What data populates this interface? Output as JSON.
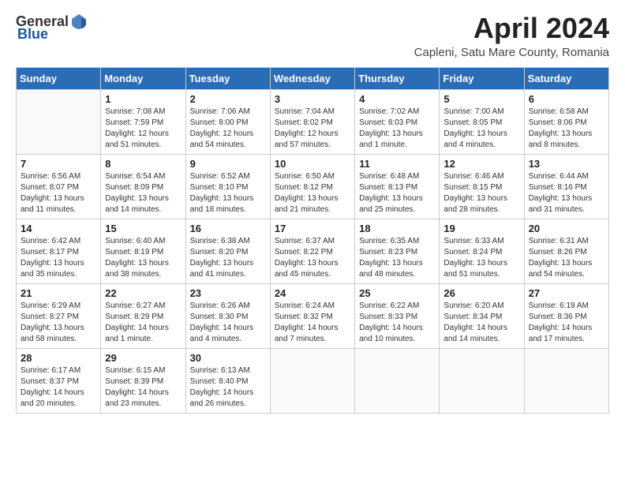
{
  "header": {
    "logo_general": "General",
    "logo_blue": "Blue",
    "month_title": "April 2024",
    "location": "Capleni, Satu Mare County, Romania"
  },
  "days_of_week": [
    "Sunday",
    "Monday",
    "Tuesday",
    "Wednesday",
    "Thursday",
    "Friday",
    "Saturday"
  ],
  "weeks": [
    [
      {
        "day": "",
        "sunrise": "",
        "sunset": "",
        "daylight": ""
      },
      {
        "day": "1",
        "sunrise": "Sunrise: 7:08 AM",
        "sunset": "Sunset: 7:59 PM",
        "daylight": "Daylight: 12 hours and 51 minutes."
      },
      {
        "day": "2",
        "sunrise": "Sunrise: 7:06 AM",
        "sunset": "Sunset: 8:00 PM",
        "daylight": "Daylight: 12 hours and 54 minutes."
      },
      {
        "day": "3",
        "sunrise": "Sunrise: 7:04 AM",
        "sunset": "Sunset: 8:02 PM",
        "daylight": "Daylight: 12 hours and 57 minutes."
      },
      {
        "day": "4",
        "sunrise": "Sunrise: 7:02 AM",
        "sunset": "Sunset: 8:03 PM",
        "daylight": "Daylight: 13 hours and 1 minute."
      },
      {
        "day": "5",
        "sunrise": "Sunrise: 7:00 AM",
        "sunset": "Sunset: 8:05 PM",
        "daylight": "Daylight: 13 hours and 4 minutes."
      },
      {
        "day": "6",
        "sunrise": "Sunrise: 6:58 AM",
        "sunset": "Sunset: 8:06 PM",
        "daylight": "Daylight: 13 hours and 8 minutes."
      }
    ],
    [
      {
        "day": "7",
        "sunrise": "Sunrise: 6:56 AM",
        "sunset": "Sunset: 8:07 PM",
        "daylight": "Daylight: 13 hours and 11 minutes."
      },
      {
        "day": "8",
        "sunrise": "Sunrise: 6:54 AM",
        "sunset": "Sunset: 8:09 PM",
        "daylight": "Daylight: 13 hours and 14 minutes."
      },
      {
        "day": "9",
        "sunrise": "Sunrise: 6:52 AM",
        "sunset": "Sunset: 8:10 PM",
        "daylight": "Daylight: 13 hours and 18 minutes."
      },
      {
        "day": "10",
        "sunrise": "Sunrise: 6:50 AM",
        "sunset": "Sunset: 8:12 PM",
        "daylight": "Daylight: 13 hours and 21 minutes."
      },
      {
        "day": "11",
        "sunrise": "Sunrise: 6:48 AM",
        "sunset": "Sunset: 8:13 PM",
        "daylight": "Daylight: 13 hours and 25 minutes."
      },
      {
        "day": "12",
        "sunrise": "Sunrise: 6:46 AM",
        "sunset": "Sunset: 8:15 PM",
        "daylight": "Daylight: 13 hours and 28 minutes."
      },
      {
        "day": "13",
        "sunrise": "Sunrise: 6:44 AM",
        "sunset": "Sunset: 8:16 PM",
        "daylight": "Daylight: 13 hours and 31 minutes."
      }
    ],
    [
      {
        "day": "14",
        "sunrise": "Sunrise: 6:42 AM",
        "sunset": "Sunset: 8:17 PM",
        "daylight": "Daylight: 13 hours and 35 minutes."
      },
      {
        "day": "15",
        "sunrise": "Sunrise: 6:40 AM",
        "sunset": "Sunset: 8:19 PM",
        "daylight": "Daylight: 13 hours and 38 minutes."
      },
      {
        "day": "16",
        "sunrise": "Sunrise: 6:38 AM",
        "sunset": "Sunset: 8:20 PM",
        "daylight": "Daylight: 13 hours and 41 minutes."
      },
      {
        "day": "17",
        "sunrise": "Sunrise: 6:37 AM",
        "sunset": "Sunset: 8:22 PM",
        "daylight": "Daylight: 13 hours and 45 minutes."
      },
      {
        "day": "18",
        "sunrise": "Sunrise: 6:35 AM",
        "sunset": "Sunset: 8:23 PM",
        "daylight": "Daylight: 13 hours and 48 minutes."
      },
      {
        "day": "19",
        "sunrise": "Sunrise: 6:33 AM",
        "sunset": "Sunset: 8:24 PM",
        "daylight": "Daylight: 13 hours and 51 minutes."
      },
      {
        "day": "20",
        "sunrise": "Sunrise: 6:31 AM",
        "sunset": "Sunset: 8:26 PM",
        "daylight": "Daylight: 13 hours and 54 minutes."
      }
    ],
    [
      {
        "day": "21",
        "sunrise": "Sunrise: 6:29 AM",
        "sunset": "Sunset: 8:27 PM",
        "daylight": "Daylight: 13 hours and 58 minutes."
      },
      {
        "day": "22",
        "sunrise": "Sunrise: 6:27 AM",
        "sunset": "Sunset: 8:29 PM",
        "daylight": "Daylight: 14 hours and 1 minute."
      },
      {
        "day": "23",
        "sunrise": "Sunrise: 6:26 AM",
        "sunset": "Sunset: 8:30 PM",
        "daylight": "Daylight: 14 hours and 4 minutes."
      },
      {
        "day": "24",
        "sunrise": "Sunrise: 6:24 AM",
        "sunset": "Sunset: 8:32 PM",
        "daylight": "Daylight: 14 hours and 7 minutes."
      },
      {
        "day": "25",
        "sunrise": "Sunrise: 6:22 AM",
        "sunset": "Sunset: 8:33 PM",
        "daylight": "Daylight: 14 hours and 10 minutes."
      },
      {
        "day": "26",
        "sunrise": "Sunrise: 6:20 AM",
        "sunset": "Sunset: 8:34 PM",
        "daylight": "Daylight: 14 hours and 14 minutes."
      },
      {
        "day": "27",
        "sunrise": "Sunrise: 6:19 AM",
        "sunset": "Sunset: 8:36 PM",
        "daylight": "Daylight: 14 hours and 17 minutes."
      }
    ],
    [
      {
        "day": "28",
        "sunrise": "Sunrise: 6:17 AM",
        "sunset": "Sunset: 8:37 PM",
        "daylight": "Daylight: 14 hours and 20 minutes."
      },
      {
        "day": "29",
        "sunrise": "Sunrise: 6:15 AM",
        "sunset": "Sunset: 8:39 PM",
        "daylight": "Daylight: 14 hours and 23 minutes."
      },
      {
        "day": "30",
        "sunrise": "Sunrise: 6:13 AM",
        "sunset": "Sunset: 8:40 PM",
        "daylight": "Daylight: 14 hours and 26 minutes."
      },
      {
        "day": "",
        "sunrise": "",
        "sunset": "",
        "daylight": ""
      },
      {
        "day": "",
        "sunrise": "",
        "sunset": "",
        "daylight": ""
      },
      {
        "day": "",
        "sunrise": "",
        "sunset": "",
        "daylight": ""
      },
      {
        "day": "",
        "sunrise": "",
        "sunset": "",
        "daylight": ""
      }
    ]
  ]
}
